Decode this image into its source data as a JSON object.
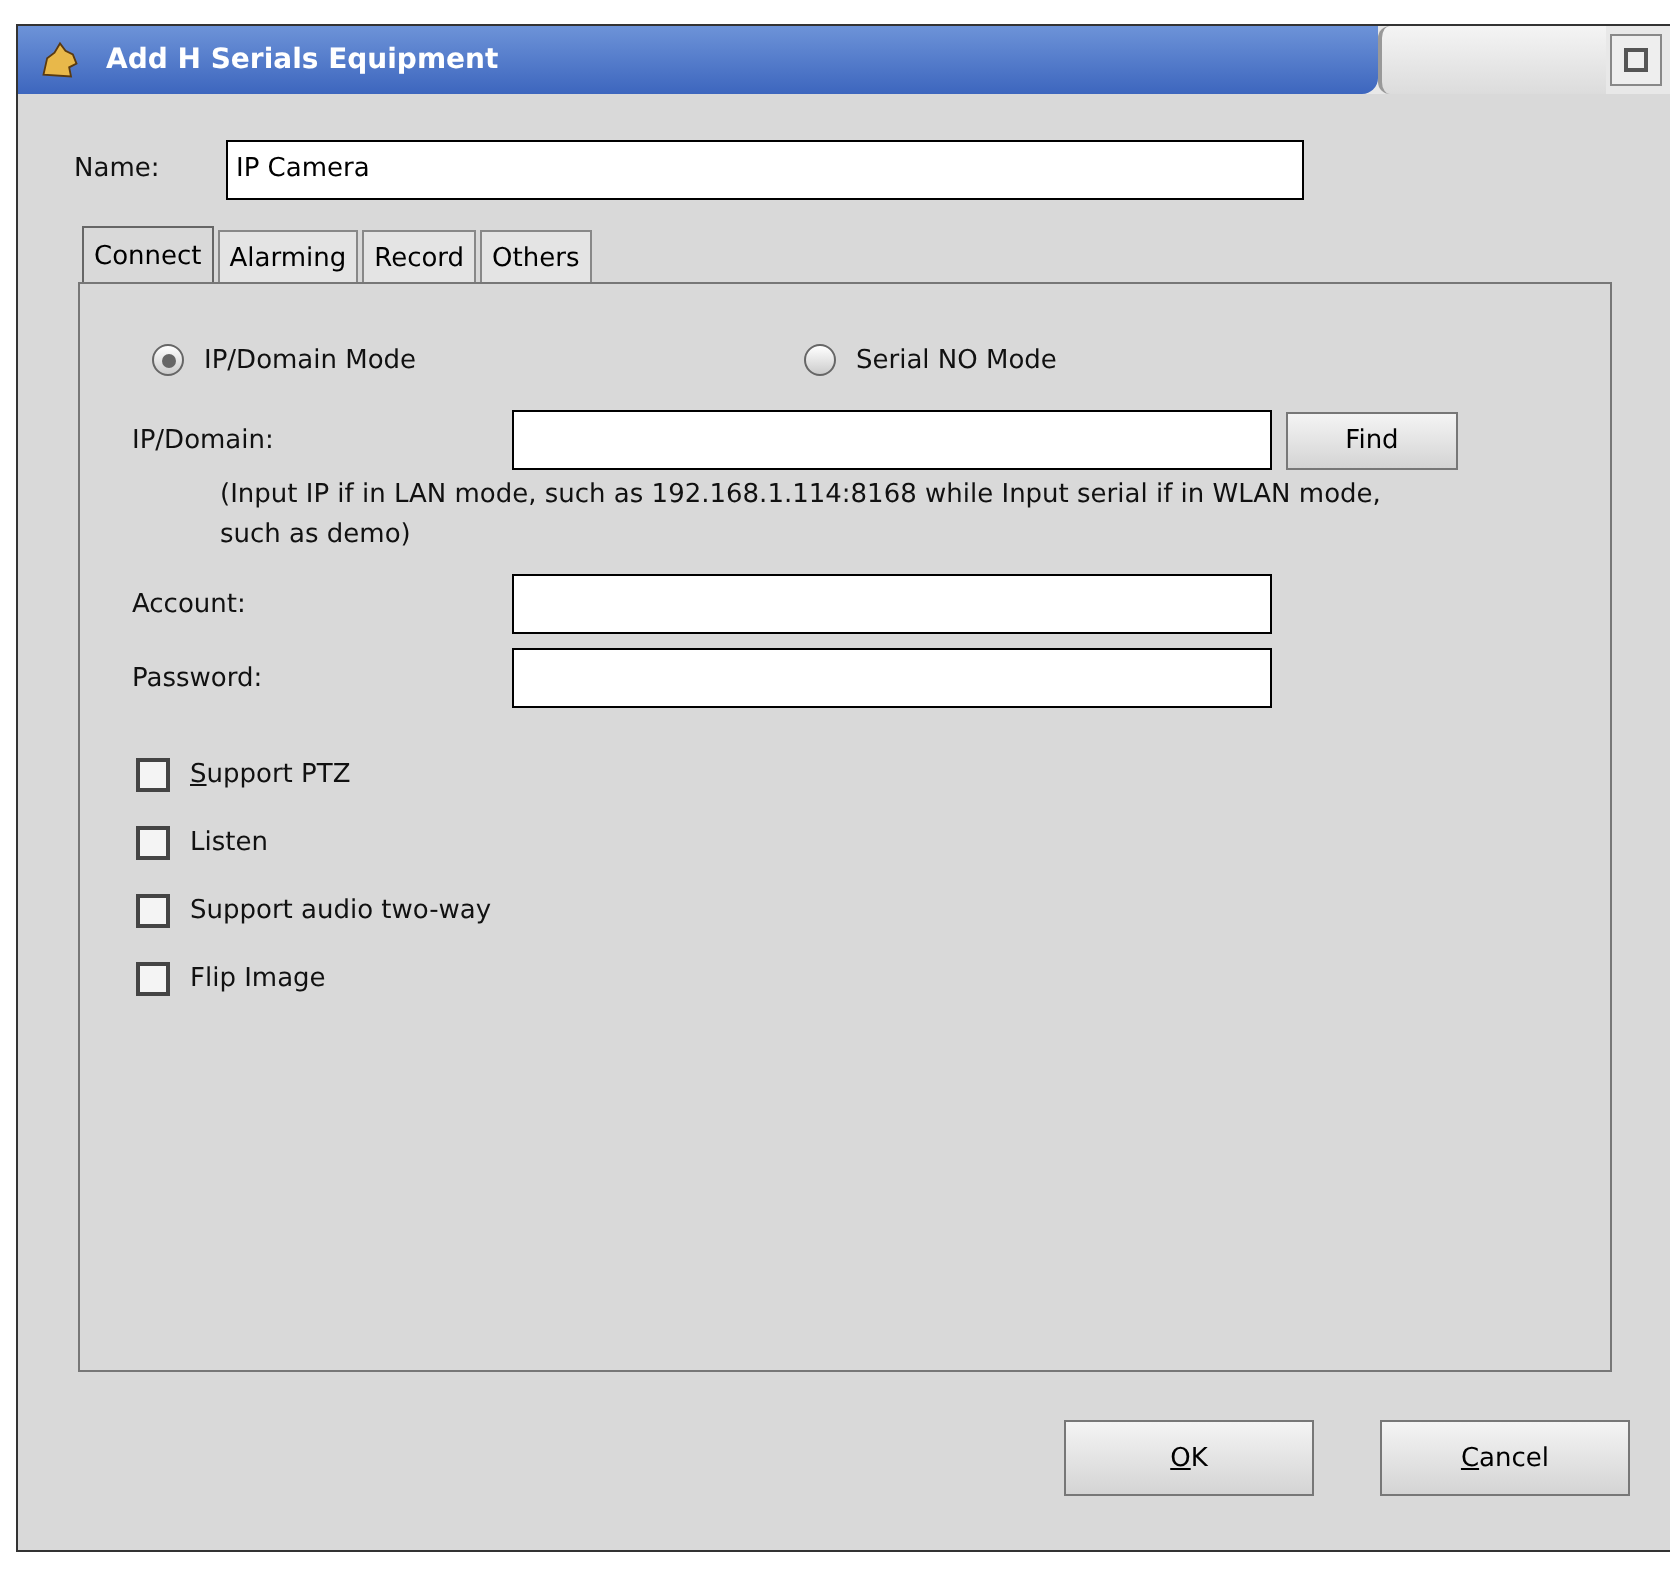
{
  "window": {
    "title": "Add H Serials Equipment"
  },
  "name_field": {
    "label": "Name:",
    "value": "IP Camera"
  },
  "tabs": [
    {
      "label": "Connect",
      "selected": true
    },
    {
      "label": "Alarming",
      "selected": false
    },
    {
      "label": "Record",
      "selected": false
    },
    {
      "label": "Others",
      "selected": false
    }
  ],
  "modes": [
    {
      "label": "IP/Domain Mode",
      "selected": true
    },
    {
      "label": "Serial NO Mode",
      "selected": false
    }
  ],
  "ip_domain": {
    "label": "IP/Domain:",
    "button": "Find",
    "hint": "(Input IP if in LAN mode, such as 192.168.1.114:8168 while Input serial if in WLAN mode, such as demo)"
  },
  "account": {
    "label": "Account:"
  },
  "password": {
    "label": "Password:"
  },
  "options": [
    {
      "label": "Support PTZ",
      "checked": false,
      "mnemonic": true
    },
    {
      "label": "Listen",
      "checked": false,
      "mnemonic": false
    },
    {
      "label": "Support audio two-way",
      "checked": false,
      "mnemonic": false
    },
    {
      "label": "Flip Image",
      "checked": false,
      "mnemonic": false
    }
  ],
  "buttons": [
    {
      "label": "OK",
      "mnemonic": true
    },
    {
      "label": "Cancel",
      "mnemonic": true
    }
  ]
}
